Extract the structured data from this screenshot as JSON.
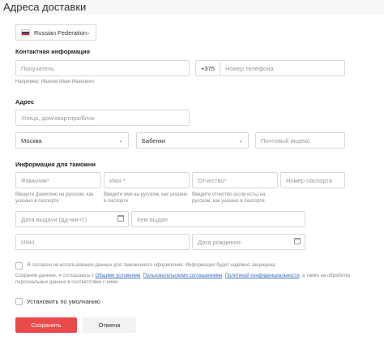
{
  "page": {
    "title": "Адреса доставки"
  },
  "country": {
    "value": "Russian Federation",
    "flag": "russia-flag-icon"
  },
  "contact": {
    "heading": "Контактная информация",
    "name_placeholder": "Получатель",
    "name_hint": "Например: Иванов Иван Иванович",
    "phone_code": "+375",
    "phone_placeholder": "Номер телефона"
  },
  "address": {
    "heading": "Адрес",
    "street_placeholder": "Улица, дом/квартира/блок",
    "region": "Москва",
    "city": "Бабенки",
    "zip_placeholder": "Почтовый индекс"
  },
  "customs": {
    "heading": "Информация для таможни",
    "surname_placeholder": "Фамилия*",
    "surname_hint": "Введите фамилию на русском, как указано в паспорте",
    "firstname_placeholder": "Имя *",
    "firstname_hint": "Введите имя на русском, как указано в паспорте",
    "patronymic_placeholder": "Отчество*",
    "patronymic_hint": "Введите отчество (если есть) на русском, как указано в паспорте",
    "passport_placeholder": "Номер паспорта",
    "issue_date_placeholder": "Дата выдачи (дд-мм-гг)",
    "issued_by_placeholder": "Кем выдан",
    "inn_placeholder": "ИНН",
    "birthdate_placeholder": "Дата рождения"
  },
  "consent": {
    "checkbox_label": "Я согласен на использование данных для таможенного оформления. Информация будет надёжно защищена",
    "text_prefix": "Сохраняя данные, я соглашаюсь с ",
    "link1": "Общими условиями",
    "sep1": ", ",
    "link2": "Пользовательскими соглашениями",
    "sep2": ", ",
    "link3": "Политикой конфиденциальности",
    "text_suffix": ", а также на обработку персональных данных в соответствии с ними"
  },
  "default_label": "Установить по умолчанию",
  "buttons": {
    "save": "Сохранить",
    "cancel": "Отмена"
  },
  "colors": {
    "accent": "#e94a4a",
    "link": "#3b6fb6"
  }
}
